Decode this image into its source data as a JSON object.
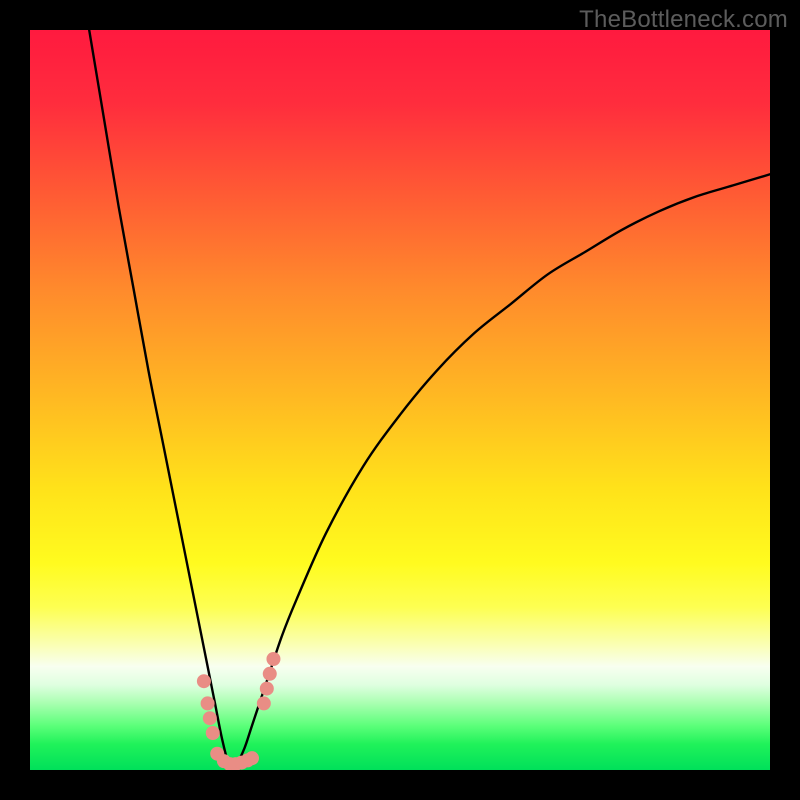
{
  "watermark": "TheBottleneck.com",
  "gradient": {
    "stops": [
      {
        "offset": 0.0,
        "color": "#ff1a3f"
      },
      {
        "offset": 0.1,
        "color": "#ff2d3d"
      },
      {
        "offset": 0.22,
        "color": "#ff5a34"
      },
      {
        "offset": 0.35,
        "color": "#ff8a2c"
      },
      {
        "offset": 0.5,
        "color": "#ffba22"
      },
      {
        "offset": 0.62,
        "color": "#ffe21a"
      },
      {
        "offset": 0.72,
        "color": "#fffb1f"
      },
      {
        "offset": 0.78,
        "color": "#fdff52"
      },
      {
        "offset": 0.83,
        "color": "#faffb2"
      },
      {
        "offset": 0.86,
        "color": "#f8fff0"
      },
      {
        "offset": 0.885,
        "color": "#dfffe0"
      },
      {
        "offset": 0.91,
        "color": "#a8ffb0"
      },
      {
        "offset": 0.94,
        "color": "#5cff7a"
      },
      {
        "offset": 0.965,
        "color": "#20f25a"
      },
      {
        "offset": 1.0,
        "color": "#00e05a"
      }
    ]
  },
  "chart_data": {
    "type": "line",
    "title": "",
    "xlabel": "",
    "ylabel": "",
    "x_range": [
      0,
      100
    ],
    "y_range": [
      0,
      100
    ],
    "curve_note": "Bottleneck-percentage style curve: sharp V reaching ~0 near x≈27; right branch rises with diminishing slope to ~80 at x=100; left branch rises steeply toward ~100 at x≈8.",
    "series": [
      {
        "name": "bottleneck-curve",
        "x": [
          8,
          10,
          12,
          14,
          16,
          18,
          20,
          22,
          24,
          25,
          26,
          27,
          28,
          29,
          30,
          32,
          34,
          36,
          40,
          45,
          50,
          55,
          60,
          65,
          70,
          75,
          80,
          85,
          90,
          95,
          100
        ],
        "y": [
          100,
          88,
          76,
          65,
          54,
          44,
          34,
          24,
          14,
          9,
          4,
          0.5,
          1,
          3,
          6,
          12,
          18,
          23,
          32,
          41,
          48,
          54,
          59,
          63,
          67,
          70,
          73,
          75.5,
          77.5,
          79,
          80.5
        ]
      }
    ],
    "markers": {
      "note": "Pink bead clusters near the curve minimum",
      "color": "#e98d85",
      "points": [
        {
          "x": 23.5,
          "y": 12
        },
        {
          "x": 24.0,
          "y": 9
        },
        {
          "x": 24.3,
          "y": 7
        },
        {
          "x": 24.7,
          "y": 5
        },
        {
          "x": 25.3,
          "y": 2.2
        },
        {
          "x": 26.2,
          "y": 1.2
        },
        {
          "x": 27.0,
          "y": 0.8
        },
        {
          "x": 27.8,
          "y": 0.8
        },
        {
          "x": 28.6,
          "y": 1.0
        },
        {
          "x": 29.4,
          "y": 1.3
        },
        {
          "x": 30.0,
          "y": 1.6
        },
        {
          "x": 31.6,
          "y": 9
        },
        {
          "x": 32.0,
          "y": 11
        },
        {
          "x": 32.4,
          "y": 13
        },
        {
          "x": 32.9,
          "y": 15
        }
      ]
    }
  }
}
